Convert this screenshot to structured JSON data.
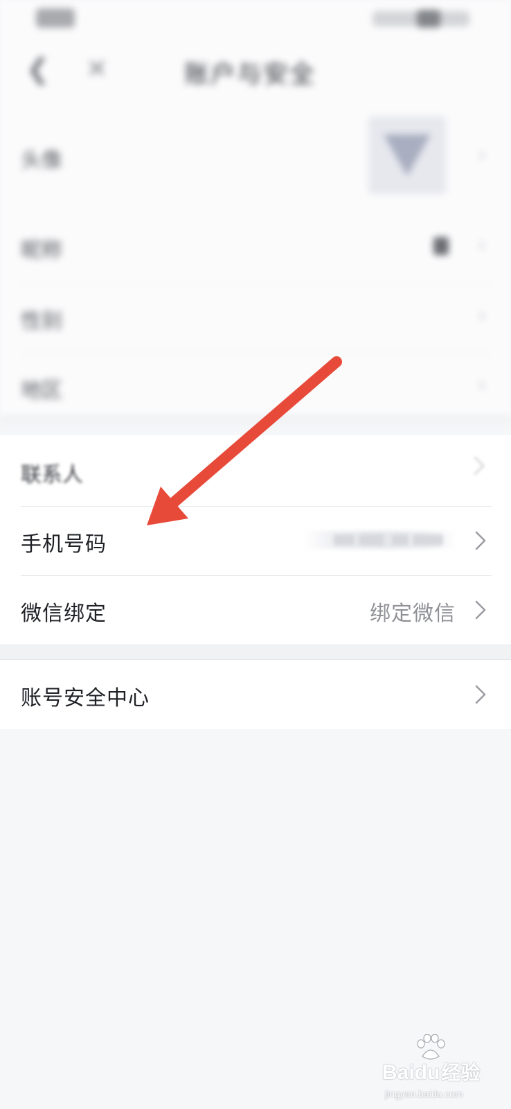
{
  "status_bar": {
    "time": "",
    "icons": [
      "signal-icon",
      "wifi-icon",
      "battery-icon"
    ]
  },
  "nav": {
    "back_icon": "chevron-left-icon",
    "close_icon": "close-icon",
    "title": "账户与安全"
  },
  "blurred_rows": [
    {
      "label": "头像"
    },
    {
      "label": "昵称"
    },
    {
      "label": "性别"
    },
    {
      "label": "地区"
    }
  ],
  "rows": {
    "contact": {
      "label": "联系人"
    },
    "phone": {
      "label": "手机号码",
      "value_masked": true
    },
    "wechat": {
      "label": "微信绑定",
      "value": "绑定微信"
    },
    "security_center": {
      "label": "账号安全中心"
    }
  },
  "annotation": {
    "type": "arrow",
    "color": "#e84a3a",
    "points_to": "phone"
  },
  "watermark": {
    "brand_latin": "Baidu",
    "brand_cn": "经验",
    "url": "jingyan.baidu.com"
  },
  "colors": {
    "background": "#f6f7f9",
    "row_bg": "#ffffff",
    "text_primary": "#1f2126",
    "text_secondary": "#8f9196",
    "chevron": "#9a9ca1",
    "arrow": "#e84a3a"
  }
}
